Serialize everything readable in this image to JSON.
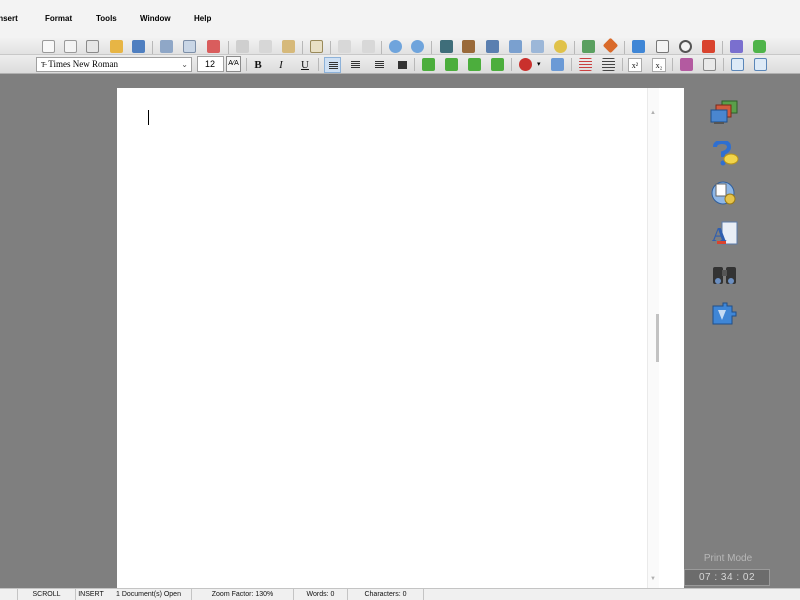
{
  "menu": [
    {
      "label": "Insert",
      "accel": "I",
      "rest": "nsert"
    },
    {
      "label": "Format",
      "accel": "o",
      "pre": "F",
      "rest": "rmat"
    },
    {
      "label": "Tools",
      "accel": "T",
      "rest": "ools"
    },
    {
      "label": "Window",
      "accel": "W",
      "rest": "indow"
    },
    {
      "label": "Help",
      "accel": "H",
      "rest": "elp"
    }
  ],
  "format_toolbar": {
    "font_name": "Times New Roman",
    "font_type_glyph": "T̶",
    "font_dropdown_glyph": "⌄",
    "font_size": "12",
    "size_stepper_glyph": "A⁄A",
    "bold": "B",
    "italic": "I",
    "underline": "U",
    "superscript": "x²",
    "subscript": "x₂"
  },
  "document": {
    "cursor_visible": true
  },
  "print_mode_label": "Print Mode",
  "clock": "07 : 34 : 02",
  "status": {
    "scroll": "SCROLL",
    "insert": "INSERT",
    "documents": "1 Document(s) Open",
    "zoom": "Zoom Factor: 130%",
    "words": "Words: 0",
    "characters": "Characters: 0"
  },
  "colors": {
    "workspace": "#7f7f7f",
    "menubar": "#f3f3f3",
    "active_align": "#cfe0f3"
  }
}
